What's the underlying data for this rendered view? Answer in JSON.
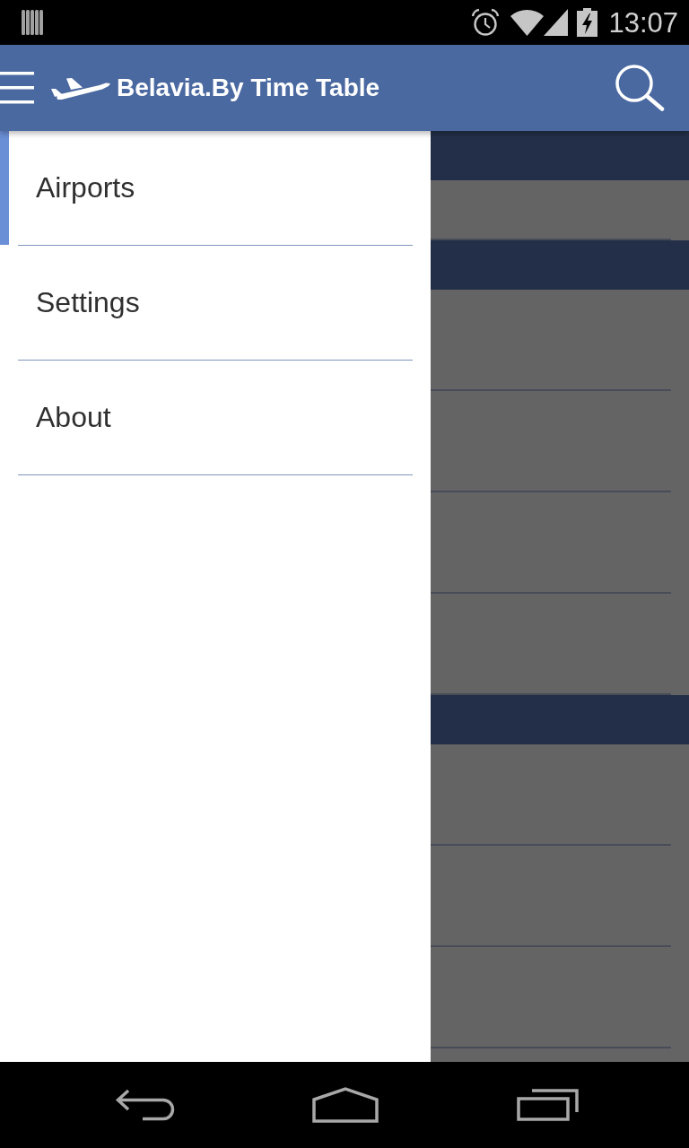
{
  "status_bar": {
    "time": "13:07"
  },
  "app_bar": {
    "title": "Belavia.By Time Table"
  },
  "drawer": {
    "items": [
      {
        "label": "Airports",
        "selected": true
      },
      {
        "label": "Settings",
        "selected": false
      },
      {
        "label": "About",
        "selected": false
      }
    ]
  }
}
